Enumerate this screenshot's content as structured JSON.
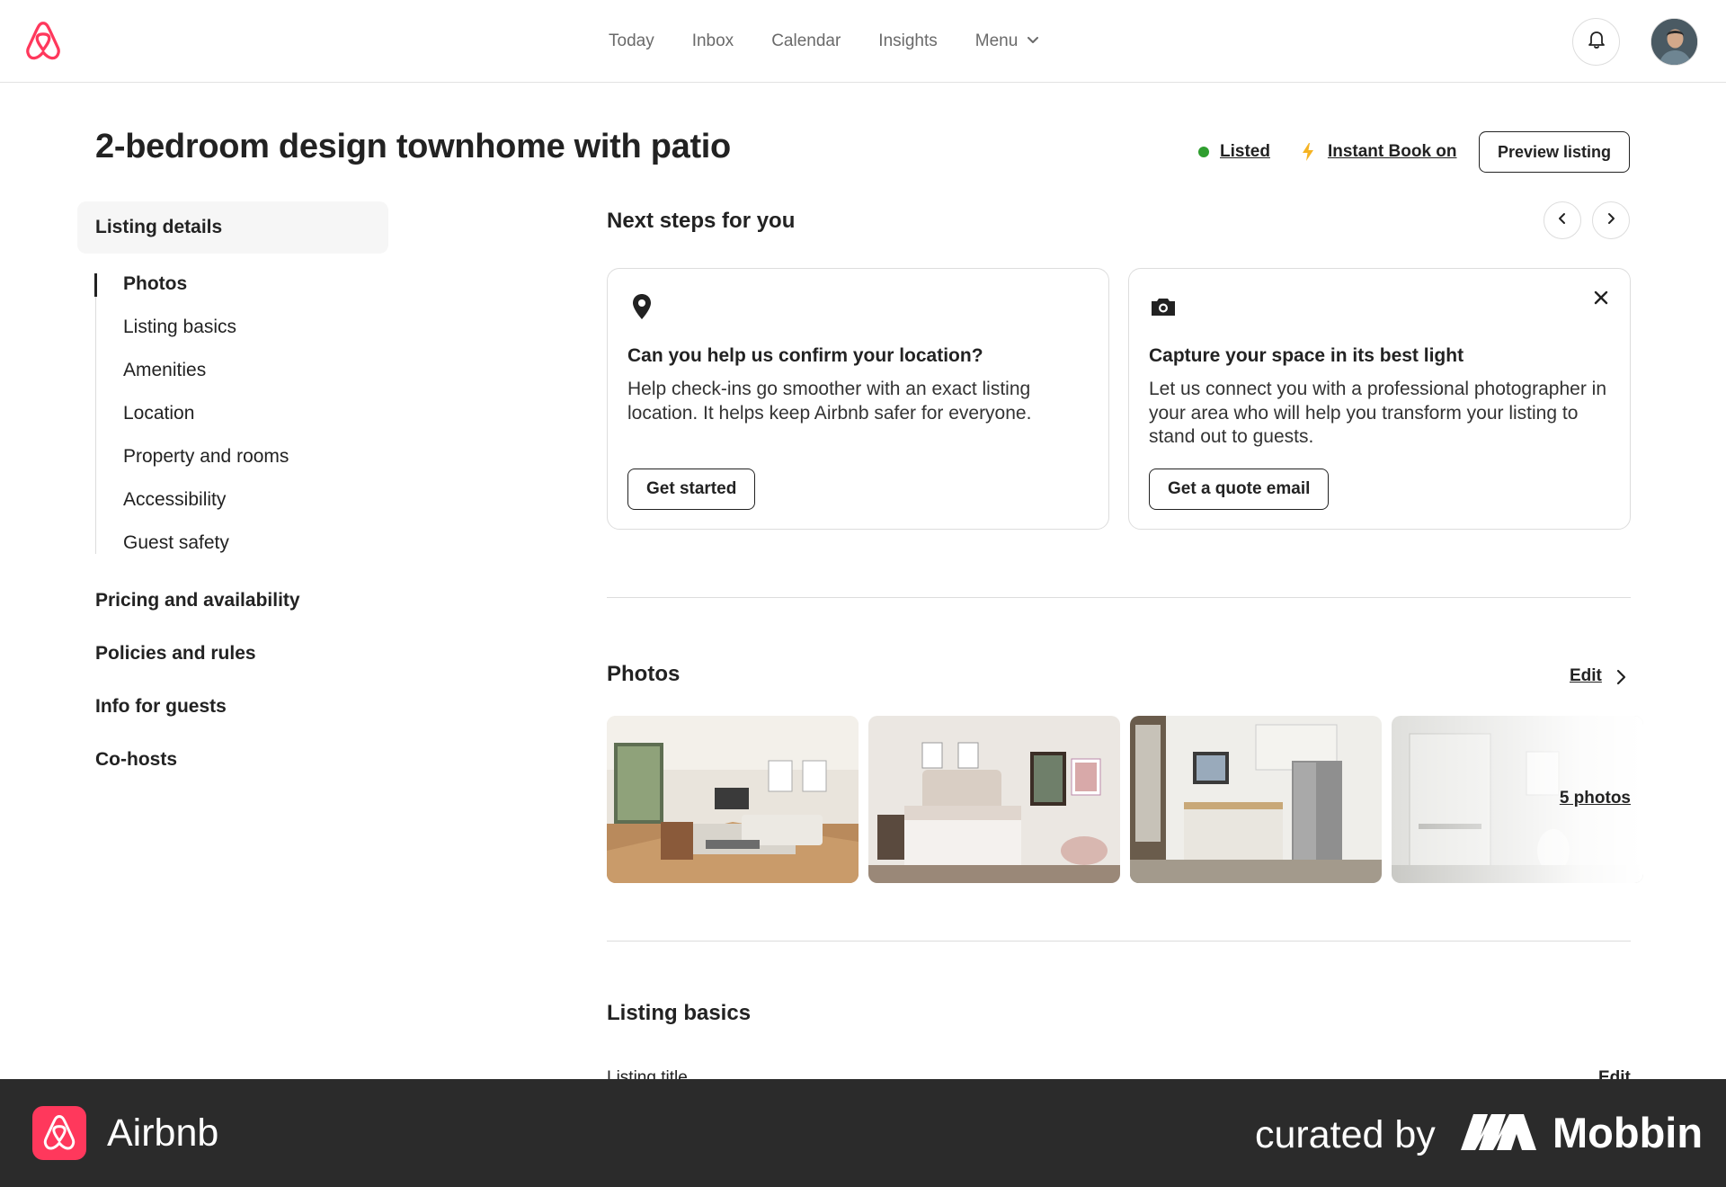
{
  "nav": {
    "links": [
      "Today",
      "Inbox",
      "Calendar",
      "Insights"
    ],
    "menu_label": "Menu"
  },
  "header": {
    "title": "2-bedroom design townhome with patio",
    "status_label": "Listed",
    "instant_book_label": "Instant Book on",
    "preview_button": "Preview listing"
  },
  "sidebar": {
    "active_section": "Listing details",
    "subitems": [
      "Photos",
      "Listing basics",
      "Amenities",
      "Location",
      "Property and rooms",
      "Accessibility",
      "Guest safety"
    ],
    "sections": [
      "Pricing and availability",
      "Policies and rules",
      "Info for guests",
      "Co-hosts"
    ]
  },
  "next_steps": {
    "heading": "Next steps for you",
    "cards": [
      {
        "icon": "location-pin-icon",
        "title": "Can you help us confirm your location?",
        "description": "Help check-ins go smoother with an exact listing location. It helps keep Airbnb safer for everyone.",
        "button": "Get started"
      },
      {
        "icon": "camera-icon",
        "title": "Capture your space in its best light",
        "description": "Let us connect you with a professional photographer in your area who will help you transform your listing to stand out to guests.",
        "button": "Get a quote email"
      }
    ]
  },
  "photos": {
    "heading": "Photos",
    "edit_label": "Edit",
    "count_label": "5 photos"
  },
  "listing_basics": {
    "heading": "Listing basics",
    "first_row_label": "Listing title",
    "edit_label": "Edit"
  },
  "footer": {
    "app_name": "Airbnb",
    "curated_label": "curated by",
    "brand": "Mobbin"
  },
  "colors": {
    "brand": "#ff385c",
    "status_green": "#2f9e2f",
    "bolt": "#f5b323",
    "footer_bg": "#2b2b2b"
  }
}
